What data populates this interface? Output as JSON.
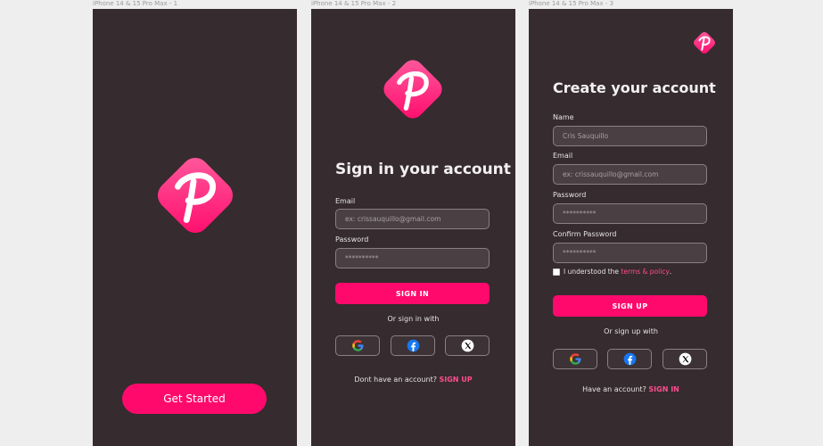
{
  "frames": [
    {
      "label": "iPhone 14 & 15 Pro Max - 1"
    },
    {
      "label": "iPhone 14 & 15 Pro Max - 2"
    },
    {
      "label": "iPhone 14 & 15 Pro Max - 3"
    }
  ],
  "colors": {
    "background": "#362b2e",
    "accent": "#ff0a6c",
    "link": "#ff4d8f",
    "input_bg": "#4a3f42",
    "input_border": "#8a8084"
  },
  "splash": {
    "logo_icon": "brand-p-logo",
    "get_started_label": "Get Started"
  },
  "signin": {
    "logo_icon": "brand-p-logo",
    "title": "Sign in your account",
    "email_label": "Email",
    "email_placeholder": "ex: crissauquillo@gmail.com",
    "password_label": "Password",
    "password_placeholder": "**********",
    "submit_label": "SIGN IN",
    "or_text": "Or sign in with",
    "social": [
      "google-icon",
      "facebook-icon",
      "x-icon"
    ],
    "footer_text": "Dont have an account?",
    "footer_link": "SIGN UP"
  },
  "signup": {
    "logo_icon": "brand-p-logo",
    "title": "Create your account",
    "name_label": "Name",
    "name_placeholder": "Cris Sauquillo",
    "email_label": "Email",
    "email_placeholder": "ex: crissauquillo@gmail.com",
    "password_label": "Password",
    "password_placeholder": "**********",
    "confirm_label": "Confirm Password",
    "confirm_placeholder": "**********",
    "terms_prefix": "I understood the",
    "terms_link": "terms & policy",
    "terms_suffix": ".",
    "submit_label": "SIGN UP",
    "or_text": "Or sign up with",
    "social": [
      "google-icon",
      "facebook-icon",
      "x-icon"
    ],
    "footer_text": "Have an account?",
    "footer_link": "SIGN IN"
  }
}
